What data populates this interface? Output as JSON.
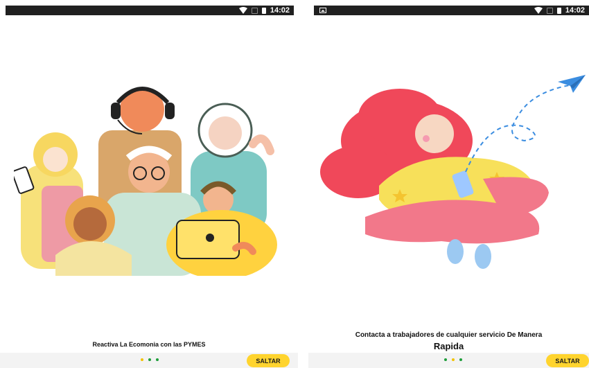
{
  "status_bar": {
    "time": "14:02"
  },
  "screen_left": {
    "caption": "Reactiva La Ecomonia con las PYMES",
    "skip_label": "SALTAR",
    "page_indicator": {
      "active_index": 0,
      "count": 3
    }
  },
  "screen_right": {
    "caption_line1": "Contacta a trabajadores de cualquier servicio De Manera",
    "caption_line2": "Rapida",
    "skip_label": "SALTAR",
    "page_indicator": {
      "active_index": 1,
      "count": 3
    }
  },
  "colors": {
    "accent": "#ffd42e",
    "dot_active": "#1e9e3a",
    "dot_inactive": "#f2c200",
    "status_bar": "#202020"
  },
  "icons": [
    "wifi-icon",
    "signal-icon",
    "battery-icon",
    "gallery-notification-icon",
    "paper-plane-icon"
  ]
}
